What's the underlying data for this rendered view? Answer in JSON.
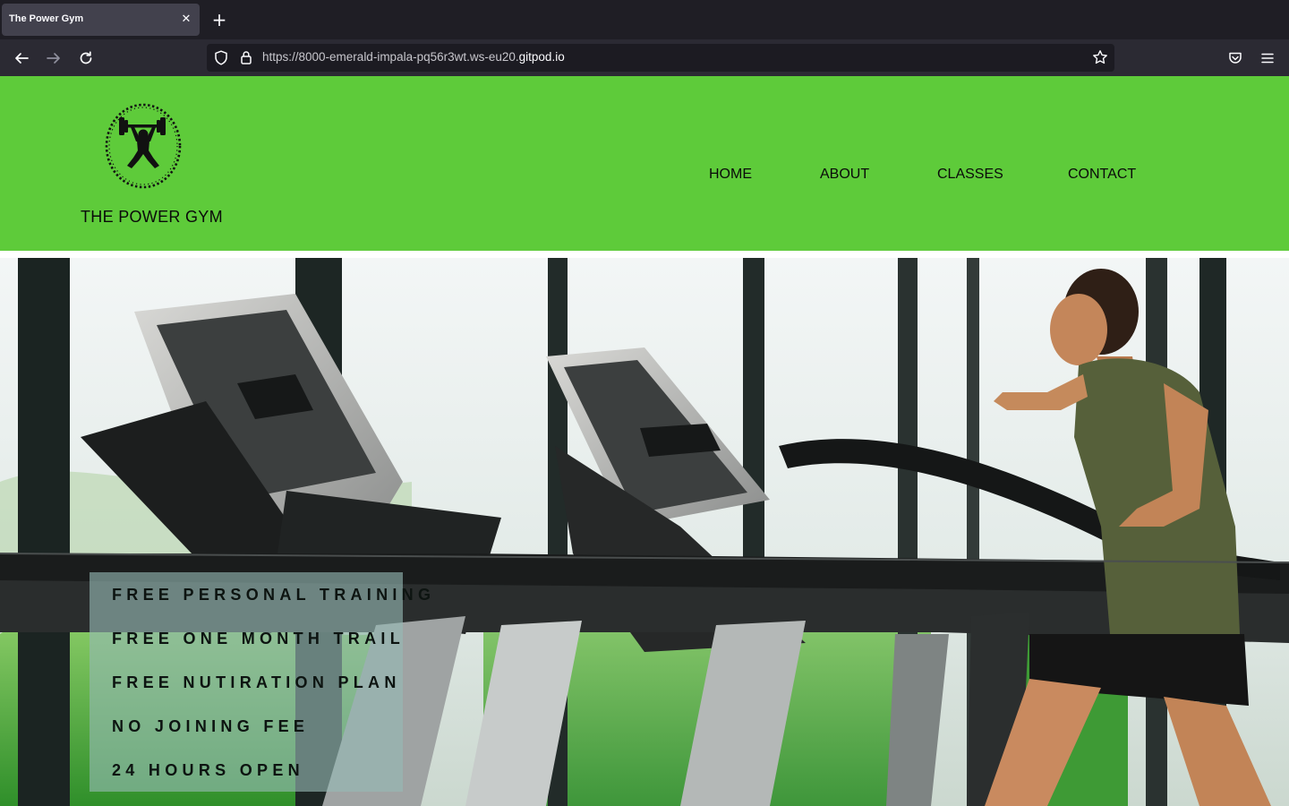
{
  "browser": {
    "tab_title": "The Power Gym",
    "tab_close_glyph": "✕",
    "new_tab_glyph": "+",
    "url_prefix": "https://8000-emerald-impala-pq56r3wt.ws-eu20.",
    "url_host": "gitpod.io",
    "icons": [
      "back-arrow-icon",
      "forward-arrow-icon",
      "reload-icon",
      "shield-icon",
      "lock-icon",
      "star-icon",
      "pocket-icon",
      "hamburger-menu-icon"
    ]
  },
  "header": {
    "brand": "THE POWER GYM",
    "background": "#5ecb3a",
    "nav": [
      "HOME",
      "ABOUT",
      "CLASSES",
      "CONTACT"
    ]
  },
  "hero": {
    "offers": [
      "FREE PERSONAL TRAINING",
      "FREE ONE MONTH TRAIL",
      "FREE NUTIRATION PLAN",
      "NO JOINING FEE",
      "24 HOURS OPEN"
    ]
  }
}
